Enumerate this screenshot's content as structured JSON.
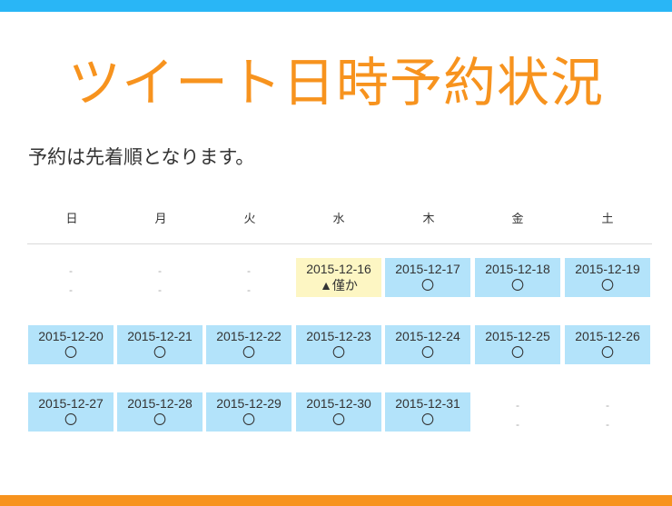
{
  "title": "ツイート日時予約状況",
  "notice": "予約は先着順となります。",
  "weekdays": [
    "日",
    "月",
    "火",
    "水",
    "木",
    "金",
    "土"
  ],
  "weeks": [
    [
      {
        "date": "-",
        "status": "-"
      },
      {
        "date": "-",
        "status": "-"
      },
      {
        "date": "-",
        "status": "-"
      },
      {
        "date": "2015-12-16",
        "status": "▲僅か"
      },
      {
        "date": "2015-12-17",
        "status": "〇"
      },
      {
        "date": "2015-12-18",
        "status": "〇"
      },
      {
        "date": "2015-12-19",
        "status": "〇"
      }
    ],
    [
      {
        "date": "2015-12-20",
        "status": "〇"
      },
      {
        "date": "2015-12-21",
        "status": "〇"
      },
      {
        "date": "2015-12-22",
        "status": "〇"
      },
      {
        "date": "2015-12-23",
        "status": "〇"
      },
      {
        "date": "2015-12-24",
        "status": "〇"
      },
      {
        "date": "2015-12-25",
        "status": "〇"
      },
      {
        "date": "2015-12-26",
        "status": "〇"
      }
    ],
    [
      {
        "date": "2015-12-27",
        "status": "〇"
      },
      {
        "date": "2015-12-28",
        "status": "〇"
      },
      {
        "date": "2015-12-29",
        "status": "〇"
      },
      {
        "date": "2015-12-30",
        "status": "〇"
      },
      {
        "date": "2015-12-31",
        "status": "〇"
      },
      {
        "date": "-",
        "status": "-"
      },
      {
        "date": "-",
        "status": "-"
      }
    ]
  ],
  "colors": {
    "accent_blue": "#29b6f6",
    "accent_orange": "#f7931e",
    "available_bg": "#b3e3fa",
    "few_bg": "#fdf6c3"
  }
}
